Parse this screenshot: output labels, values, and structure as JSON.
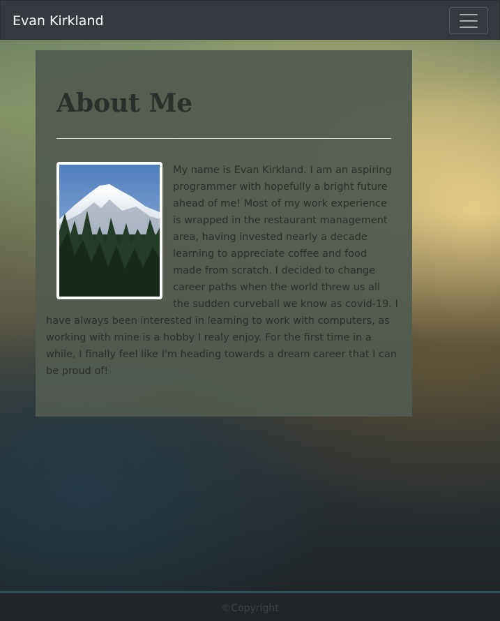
{
  "navbar": {
    "brand": "Evan Kirkland",
    "toggler_icon": "hamburger-menu-icon"
  },
  "about": {
    "title": "About Me",
    "photo_subject": "mountain-with-pine-trees",
    "paragraph": "My name is Evan Kirkland. I am an aspiring programmer with hopefully a bright future ahead of me! Most of my work experience is wrapped in the restaurant management area, having invested nearly a decade learning to appreciate coffee and food made from scratch. I decided to change career paths when the world threw us all the sudden curveball we know as covid-19. I have always been interested in learning to work with computers, as working with mine is a hobby I realy enjoy. For the first time in a while, I finally feel like I'm heading towards a dream career that I can be proud of!"
  },
  "footer": {
    "copyright": "©Copyright"
  },
  "colors": {
    "navbar": "#343a40",
    "card": "#525a50",
    "footer": "#212529",
    "footer_border": "#2f4e58"
  }
}
